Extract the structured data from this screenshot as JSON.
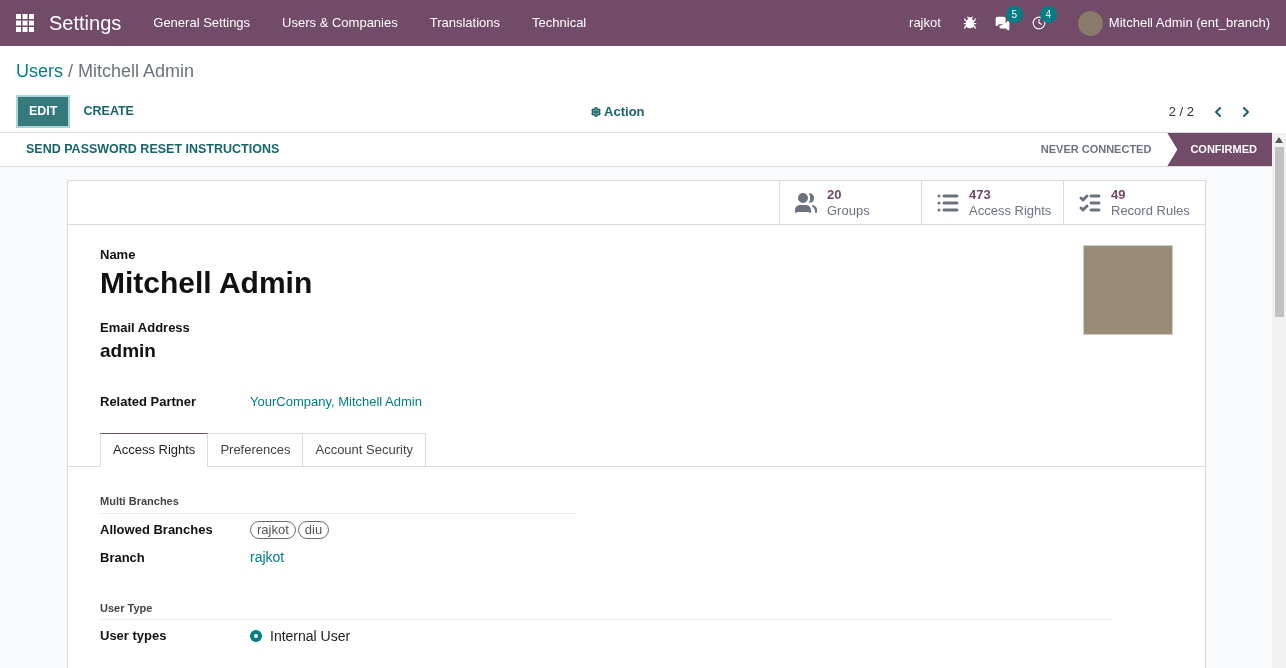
{
  "navbar": {
    "app_title": "Settings",
    "menu": [
      "General Settings",
      "Users & Companies",
      "Translations",
      "Technical"
    ],
    "branch": "rajkot",
    "messages_count": "5",
    "activities_count": "4",
    "user": "Mitchell Admin (ent_branch)"
  },
  "breadcrumb": {
    "parent": "Users",
    "separator": "/",
    "current": "Mitchell Admin"
  },
  "control_panel": {
    "edit": "EDIT",
    "create": "CREATE",
    "action": "Action",
    "pager": "2 / 2"
  },
  "statusbar": {
    "button": "SEND PASSWORD RESET INSTRUCTIONS",
    "stages": [
      {
        "label": "NEVER CONNECTED",
        "selected": false
      },
      {
        "label": "CONFIRMED",
        "selected": true
      }
    ]
  },
  "smart_buttons": [
    {
      "kind": "groups",
      "value": "20",
      "label": "Groups"
    },
    {
      "kind": "list",
      "value": "473",
      "label": "Access Rights"
    },
    {
      "kind": "bullets",
      "value": "49",
      "label": "Record Rules"
    }
  ],
  "form": {
    "name_label": "Name",
    "name": "Mitchell Admin",
    "email_label": "Email Address",
    "email": "admin",
    "partner_label": "Related Partner",
    "partner": "YourCompany, Mitchell Admin"
  },
  "tabs": [
    {
      "label": "Access Rights",
      "selected": true
    },
    {
      "label": "Preferences",
      "selected": false
    },
    {
      "label": "Account Security",
      "selected": false
    }
  ],
  "sections": [
    {
      "title": "Multi Branches",
      "fields": [
        {
          "kind": "tags",
          "label": "Allowed Branches",
          "tags": [
            "rajkot",
            "diu"
          ]
        },
        {
          "kind": "link",
          "label": "Branch",
          "value": "rajkot"
        }
      ]
    },
    {
      "title": "User Type",
      "fields": [
        {
          "kind": "radio",
          "label": "User types",
          "options": [
            {
              "label": "Internal User",
              "selected": true
            }
          ]
        }
      ]
    }
  ]
}
